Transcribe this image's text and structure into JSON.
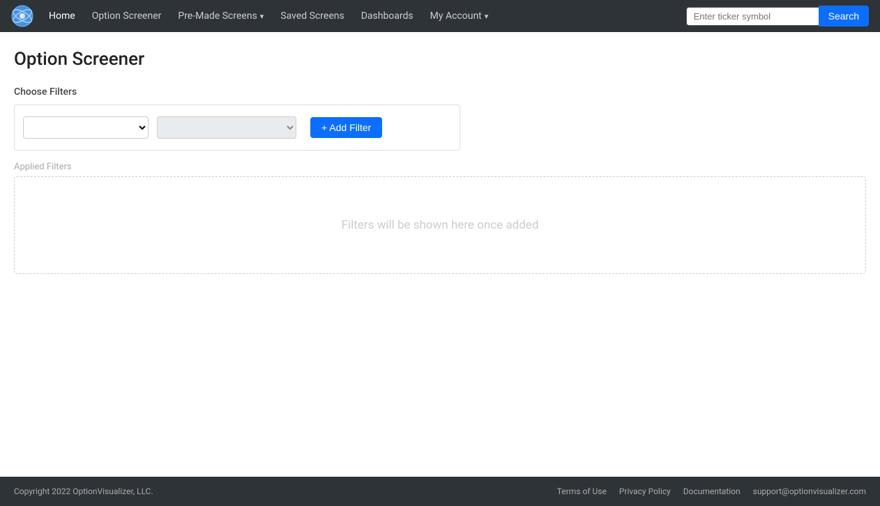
{
  "app": {
    "logo_alt": "OptionVisualizer Logo"
  },
  "navbar": {
    "links": [
      {
        "id": "home",
        "label": "Home",
        "active": true,
        "dropdown": false
      },
      {
        "id": "option-screener",
        "label": "Option Screener",
        "active": false,
        "dropdown": false
      },
      {
        "id": "pre-made-screens",
        "label": "Pre-Made Screens",
        "active": false,
        "dropdown": true
      },
      {
        "id": "saved-screens",
        "label": "Saved Screens",
        "active": false,
        "dropdown": false
      },
      {
        "id": "dashboards",
        "label": "Dashboards",
        "active": false,
        "dropdown": false
      },
      {
        "id": "my-account",
        "label": "My Account",
        "active": false,
        "dropdown": true
      }
    ],
    "search": {
      "placeholder": "Enter ticker symbol",
      "button_label": "Search"
    }
  },
  "page": {
    "title": "Option Screener",
    "choose_filters_label": "Choose Filters",
    "applied_filters_label": "Applied Filters",
    "filters_placeholder": "Filters will be shown here once added",
    "add_filter_button": "+ Add Filter",
    "filter_select1_placeholder": "",
    "filter_select2_placeholder": ""
  },
  "footer": {
    "copyright": "Copyright 2022 OptionVisualizer, LLC.",
    "links": [
      {
        "id": "terms",
        "label": "Terms of Use"
      },
      {
        "id": "privacy",
        "label": "Privacy Policy"
      },
      {
        "id": "documentation",
        "label": "Documentation"
      },
      {
        "id": "support",
        "label": "support@optionvisualizer.com"
      }
    ]
  }
}
